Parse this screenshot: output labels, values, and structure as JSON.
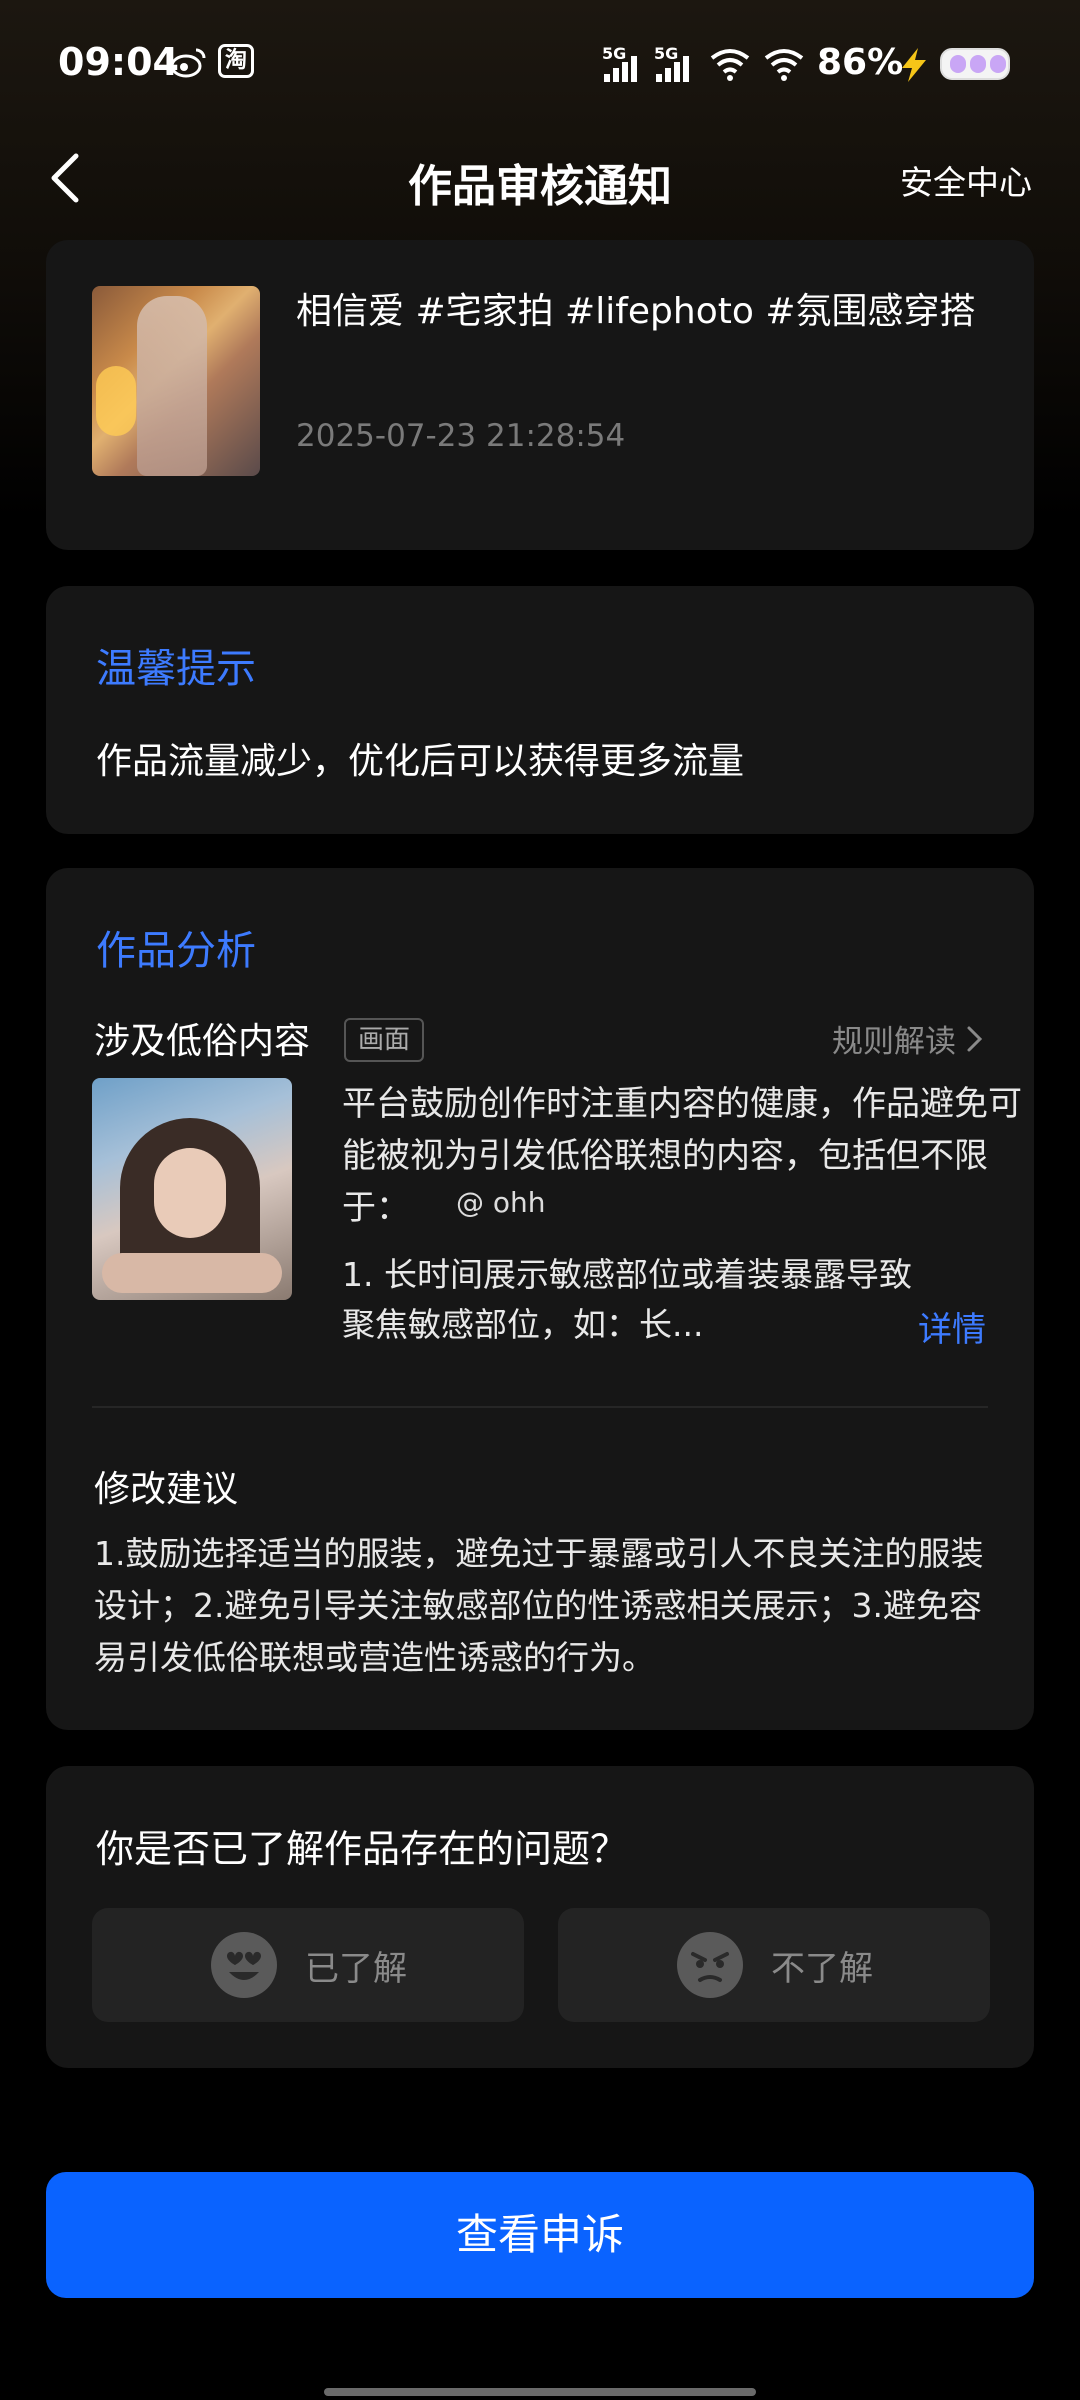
{
  "status_bar": {
    "time": "09:04",
    "taobao_glyph": "淘",
    "signal_label_1": "5G",
    "signal_label_2": "5G",
    "battery_percent": "86%",
    "icons": [
      "weibo-icon",
      "taobao-icon",
      "signal-5g-icon",
      "signal-5g-icon",
      "wifi-icon",
      "wifi-icon",
      "charging-bolt-icon",
      "battery-icon"
    ]
  },
  "header": {
    "title": "作品审核通知",
    "right_link": "安全中心",
    "back_icon": "chevron-left-icon"
  },
  "post": {
    "title": "相信爱 #宅家拍 #lifephoto #氛围感穿搭",
    "time": "2025-07-23 21:28:54"
  },
  "tip": {
    "heading": "温馨提示",
    "text": "作品流量减少，优化后可以获得更多流量"
  },
  "analysis": {
    "heading": "作品分析",
    "issue": "涉及低俗内容",
    "tag": "画面",
    "rule_link": "规则解读",
    "description": "平台鼓励创作时注重内容的健康，作品避免可能被视为引发低俗联想的内容，包括但不限于：",
    "watermark": "@ ohh",
    "detail_text": "1. 长时间展示敏感部位或着装暴露导致聚焦敏感部位，如：长...",
    "detail_link": "详情",
    "suggestion_title": "修改建议",
    "suggestion_text": "1.鼓励选择适当的服装，避免过于暴露或引人不良关注的服装设计；2.避免引导关注敏感部位的性诱惑相关展示；3.避免容易引发低俗联想或营造性诱惑的行为。"
  },
  "question": {
    "text": "你是否已了解作品存在的问题？",
    "option_yes": "已了解",
    "option_no": "不了解"
  },
  "appeal_button": "查看申诉",
  "colors": {
    "accent_blue": "#3d7bff",
    "button_blue": "#0a63ff",
    "card_bg": "#161616"
  }
}
